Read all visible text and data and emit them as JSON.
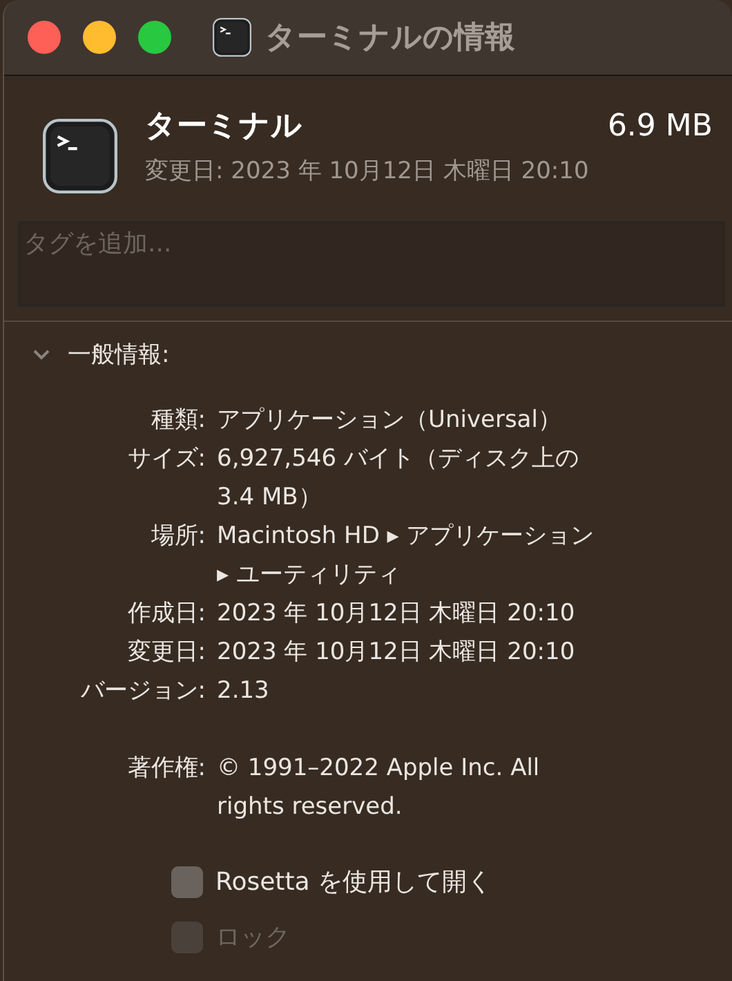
{
  "window": {
    "title": "ターミナルの情報"
  },
  "header": {
    "name": "ターミナル",
    "size": "6.9 MB",
    "modified": "変更日: 2023 年 10月12日 木曜日 20:10"
  },
  "tags_field": {
    "placeholder": "タグを追加..."
  },
  "section": {
    "title": "一般情報:",
    "expanded": true,
    "rows": [
      {
        "label": "種類:",
        "value_lines": [
          "アプリケーション（Universal）"
        ]
      },
      {
        "label": "サイズ:",
        "value_lines": [
          "6,927,546 バイト（ディスク上の",
          "3.4 MB）"
        ]
      },
      {
        "label": "場所:",
        "value_lines": [
          "Macintosh HD ▸ アプリケーション",
          "▸ ユーティリティ"
        ]
      },
      {
        "label": "作成日:",
        "value_lines": [
          "2023 年 10月12日 木曜日 20:10"
        ]
      },
      {
        "label": "変更日:",
        "value_lines": [
          "2023 年 10月12日 木曜日 20:10"
        ]
      },
      {
        "label": "バージョン:",
        "value_lines": [
          "2.13"
        ]
      },
      {
        "label": "著作権:",
        "value_lines": [
          "© 1991–2022 Apple Inc. All",
          "rights reserved."
        ],
        "spaced": true
      }
    ],
    "checkboxes": [
      {
        "label": "Rosetta を使用して開く",
        "checked": false,
        "disabled": false
      },
      {
        "label": "ロック",
        "checked": false,
        "disabled": true
      }
    ]
  }
}
